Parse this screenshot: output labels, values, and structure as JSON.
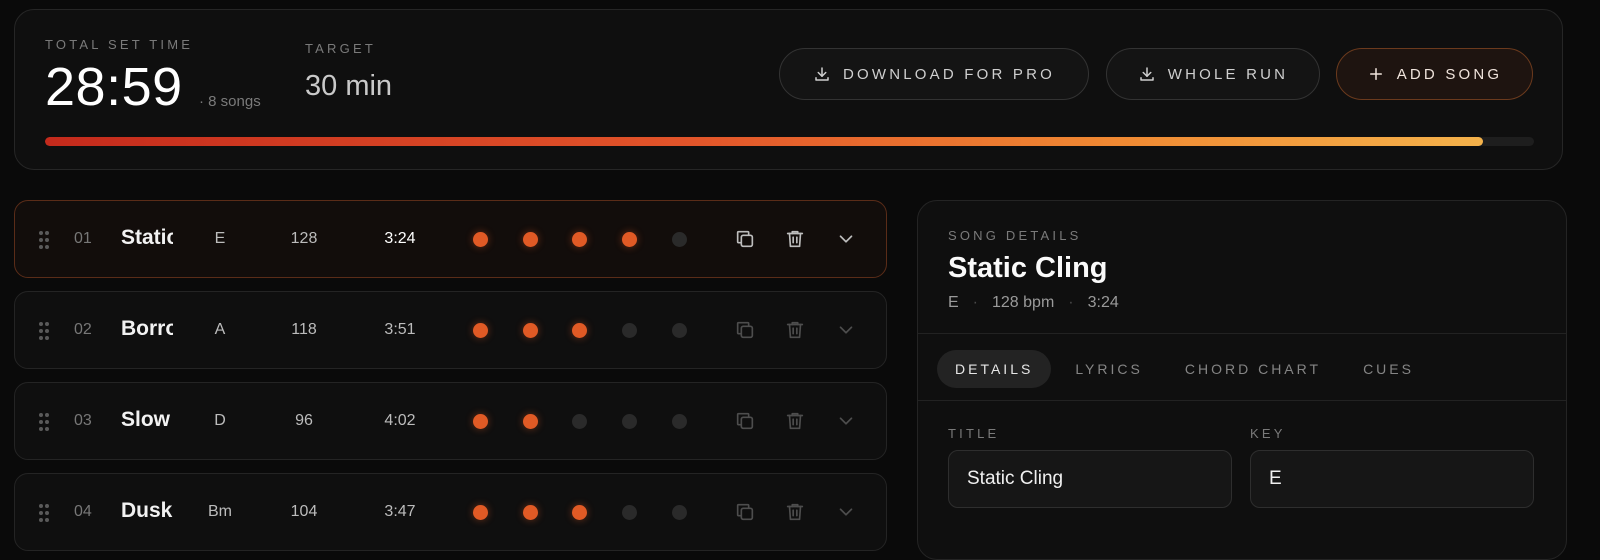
{
  "summary": {
    "total_label": "TOTAL SET TIME",
    "total_time": "28:59",
    "song_count": "· 8 songs",
    "target_label": "TARGET",
    "target_value": "30 min",
    "progress": 0.966
  },
  "buttons": {
    "download_pro": "DOWNLOAD FOR PRO",
    "whole_run": "WHOLE RUN",
    "add_song": "ADD SONG"
  },
  "songs": [
    {
      "num": "01",
      "title": "Static Cling",
      "key": "E",
      "bpm": "128",
      "duration": "3:24",
      "rating": 4,
      "active": true
    },
    {
      "num": "02",
      "title": "Borrowed",
      "key": "A",
      "bpm": "118",
      "duration": "3:51",
      "rating": 3,
      "active": false
    },
    {
      "num": "03",
      "title": "Slow",
      "key": "D",
      "bpm": "96",
      "duration": "4:02",
      "rating": 2,
      "active": false
    },
    {
      "num": "04",
      "title": "Dusk",
      "key": "Bm",
      "bpm": "104",
      "duration": "3:47",
      "rating": 3,
      "active": false
    }
  ],
  "details": {
    "section_label": "SONG DETAILS",
    "title": "Static Cling",
    "meta_key": "E",
    "meta_bpm": "128 bpm",
    "meta_duration": "3:24",
    "tabs": [
      "DETAILS",
      "LYRICS",
      "CHORD CHART",
      "CUES"
    ],
    "active_tab": 0,
    "title_field_label": "TITLE",
    "title_field_value": "Static Cling",
    "key_field_label": "KEY",
    "key_field_value": "E"
  },
  "colors": {
    "accent": "#e05a25",
    "background": "#0a0a0a"
  }
}
